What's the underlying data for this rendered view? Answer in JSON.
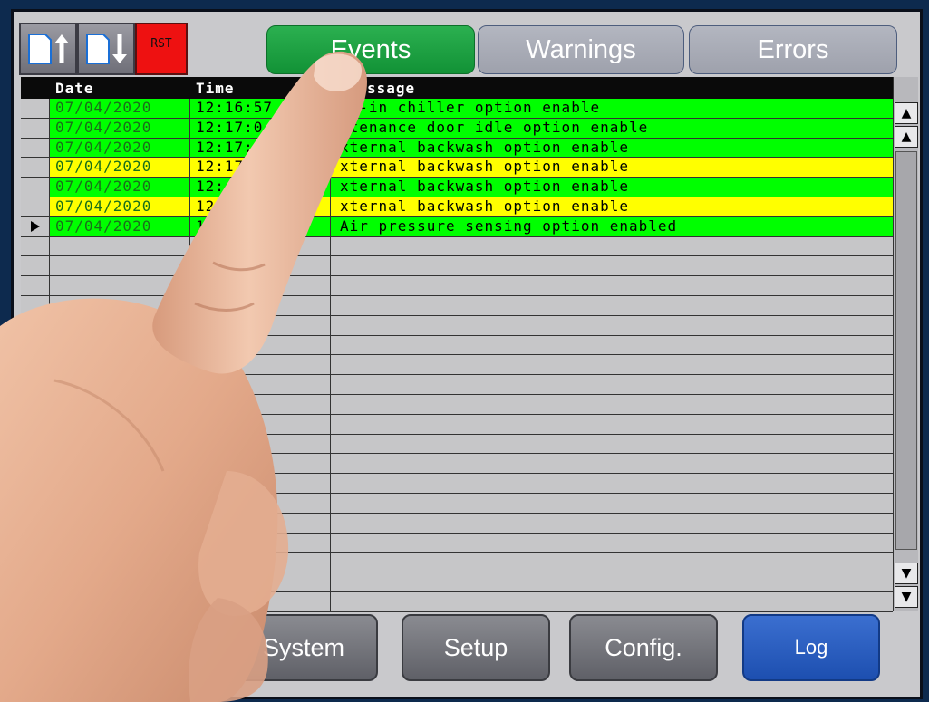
{
  "toolbar": {
    "upload_icon": "document-upload-icon",
    "download_icon": "document-download-icon",
    "reset_label": "RST"
  },
  "tabs": [
    {
      "label": "Events",
      "active": true
    },
    {
      "label": "Warnings",
      "active": false
    },
    {
      "label": "Errors",
      "active": false
    }
  ],
  "table": {
    "headers": {
      "date": "Date",
      "time": "Time",
      "message": "ssage"
    },
    "rows": [
      {
        "date": "07/04/2020",
        "time": "12:16:57",
        "message": "lt-in chiller option enable",
        "color": "green",
        "selected": false
      },
      {
        "date": "07/04/2020",
        "time": "12:17:0",
        "message": "ntenance door idle option enable",
        "color": "green",
        "selected": false
      },
      {
        "date": "07/04/2020",
        "time": "12:17:",
        "message": "xternal backwash option enable",
        "color": "green",
        "selected": false
      },
      {
        "date": "07/04/2020",
        "time": "12:17",
        "message": "xternal backwash option enable",
        "color": "yellow",
        "selected": false
      },
      {
        "date": "07/04/2020",
        "time": "12:",
        "message": "xternal backwash option enable",
        "color": "green",
        "selected": false
      },
      {
        "date": "07/04/2020",
        "time": "12",
        "message": "xternal backwash option enable",
        "color": "yellow",
        "selected": false
      },
      {
        "date": "07/04/2020",
        "time": "1",
        "message": "Air pressure sensing option enabled",
        "color": "green",
        "selected": true
      }
    ],
    "empty_rows": 19
  },
  "scrollbar": {
    "top_icon": "scroll-top-icon",
    "up_icon": "scroll-up-icon",
    "down_icon": "scroll-down-icon",
    "bottom_icon": "scroll-bottom-icon"
  },
  "nav": [
    {
      "label": "System",
      "active": false
    },
    {
      "label": "Setup",
      "active": false
    },
    {
      "label": "Config.",
      "active": false
    },
    {
      "label": "Log",
      "active": true
    }
  ],
  "colors": {
    "event_green": "#00ff00",
    "warning_yellow": "#ffff00",
    "active_tab": "#1fa344",
    "active_nav": "#2a5fc2",
    "reset_red": "#ee1111"
  }
}
